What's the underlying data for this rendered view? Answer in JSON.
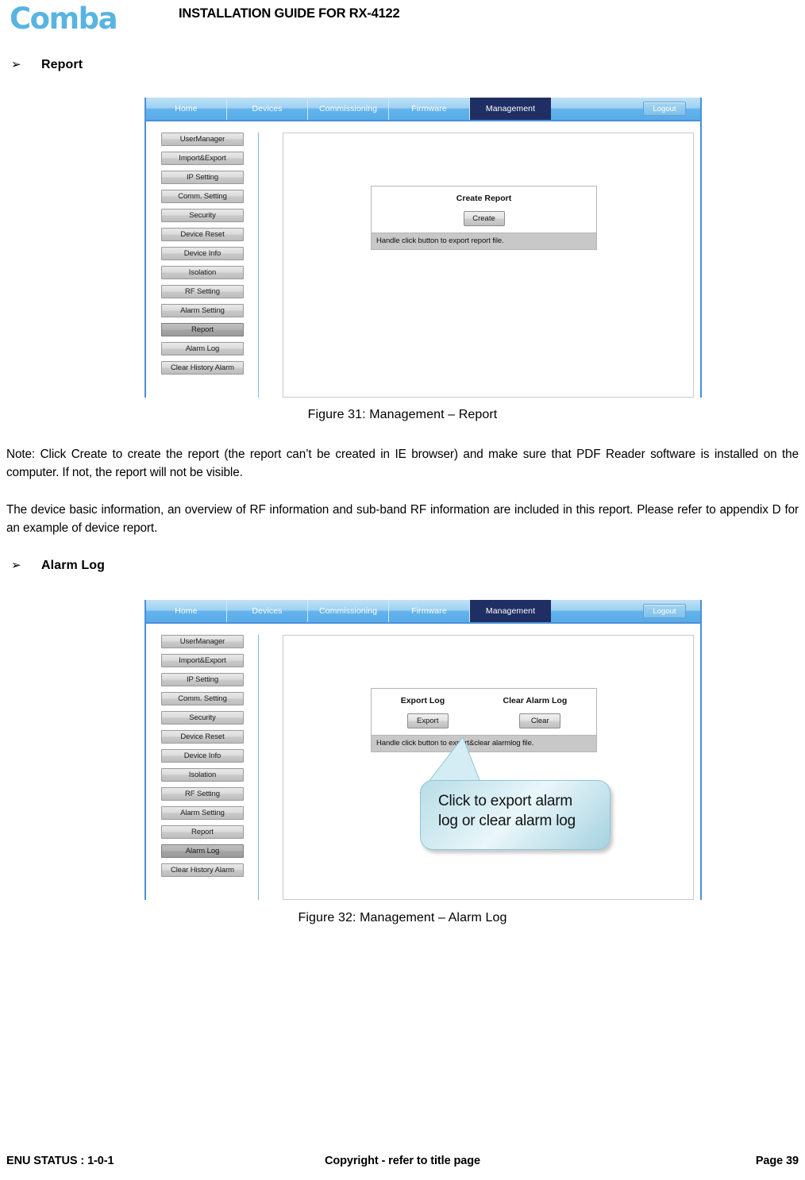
{
  "header": {
    "logo_text": "Comba",
    "logo_color": "#58b4e2",
    "doc_title": "INSTALLATION GUIDE FOR RX-4122"
  },
  "sections": [
    {
      "bullet": "➢",
      "label": "Report"
    },
    {
      "bullet": "➢",
      "label": "Alarm Log"
    }
  ],
  "screenshot_report": {
    "nav": {
      "tabs": [
        {
          "label": "Home",
          "active": false
        },
        {
          "label": "Devices",
          "active": false
        },
        {
          "label": "Commissioning",
          "active": false
        },
        {
          "label": "Firmware",
          "active": false
        },
        {
          "label": "Management",
          "active": true
        }
      ],
      "logout_label": "Logout"
    },
    "sidebar": {
      "items": [
        {
          "label": "UserManager",
          "selected": false
        },
        {
          "label": "Import&Export",
          "selected": false
        },
        {
          "label": "IP Setting",
          "selected": false
        },
        {
          "label": "Comm. Setting",
          "selected": false
        },
        {
          "label": "Security",
          "selected": false
        },
        {
          "label": "Device Reset",
          "selected": false
        },
        {
          "label": "Device Info",
          "selected": false
        },
        {
          "label": "Isolation",
          "selected": false
        },
        {
          "label": "RF Setting",
          "selected": false
        },
        {
          "label": "Alarm Setting",
          "selected": false
        },
        {
          "label": "Report",
          "selected": true
        },
        {
          "label": "Alarm Log",
          "selected": false
        },
        {
          "label": "Clear History Alarm",
          "selected": false
        }
      ]
    },
    "panel": {
      "labels": [
        "Create Report"
      ],
      "buttons": [
        "Create"
      ],
      "status": "Handle click button to export report file."
    }
  },
  "figure_31_caption": "Figure 31: Management – Report",
  "note_paragraph": "Note: Click Create to create the report (the report can’t be created in IE browser) and make sure that PDF Reader software is installed on the computer. If not, the report will not be visible.",
  "body_paragraph": "The device basic information, an overview of RF information and sub-band RF information are included in this report. Please refer to appendix D for an example of device report.",
  "screenshot_alarmlog": {
    "nav": {
      "tabs": [
        {
          "label": "Home",
          "active": false
        },
        {
          "label": "Devices",
          "active": false
        },
        {
          "label": "Commissioning",
          "active": false
        },
        {
          "label": "Firmware",
          "active": false
        },
        {
          "label": "Management",
          "active": true
        }
      ],
      "logout_label": "Logout"
    },
    "sidebar": {
      "items": [
        {
          "label": "UserManager",
          "selected": false
        },
        {
          "label": "Import&Export",
          "selected": false
        },
        {
          "label": "IP Setting",
          "selected": false
        },
        {
          "label": "Comm. Setting",
          "selected": false
        },
        {
          "label": "Security",
          "selected": false
        },
        {
          "label": "Device Reset",
          "selected": false
        },
        {
          "label": "Device Info",
          "selected": false
        },
        {
          "label": "Isolation",
          "selected": false
        },
        {
          "label": "RF Setting",
          "selected": false
        },
        {
          "label": "Alarm Setting",
          "selected": false
        },
        {
          "label": "Report",
          "selected": false
        },
        {
          "label": "Alarm Log",
          "selected": true
        },
        {
          "label": "Clear History Alarm",
          "selected": false
        }
      ]
    },
    "panel": {
      "labels": [
        "Export Log",
        "Clear Alarm Log"
      ],
      "buttons": [
        "Export",
        "Clear"
      ],
      "status": "Handle click button to export&clear alarmlog file."
    },
    "callout": {
      "text": "Click to export alarm\nlog or clear alarm log",
      "fill_color": "#cfe9f1",
      "border_color": "#8fc6d6"
    }
  },
  "figure_32_caption": "Figure 32: Management – Alarm Log",
  "footer": {
    "left": "ENU STATUS : 1-0-1",
    "center": "Copyright - refer to title page",
    "right": "Page 39"
  }
}
